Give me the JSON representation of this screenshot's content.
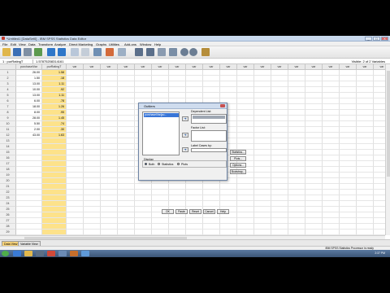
{
  "window": {
    "title": "*Untitled1 [DataSet0] - IBM SPSS Statistics Data Editor",
    "controls": [
      "_",
      "□",
      "X"
    ]
  },
  "menu": [
    "File",
    "Edit",
    "View",
    "Data",
    "Transform",
    "Analyze",
    "Direct Marketing",
    "Graphs",
    "Utilities",
    "Add-ons",
    "Window",
    "Help"
  ],
  "cellbar": {
    "ref": "1 : purRatingT",
    "value": "1.57875208314161",
    "visible": "Visible: 2 of 2 Variables"
  },
  "columns": [
    "purchaseiVar",
    "purRatingT",
    "var",
    "var",
    "var",
    "var",
    "var",
    "var",
    "var",
    "var",
    "var",
    "var",
    "var",
    "var",
    "var",
    "var",
    "var",
    "var",
    "var",
    "var",
    "var"
  ],
  "rows": [
    [
      "26.00",
      "1.58"
    ],
    [
      "1.50",
      ".18"
    ],
    [
      "13.00",
      "1.11"
    ],
    [
      "10.00",
      ".92"
    ],
    [
      "13.00",
      "1.11"
    ],
    [
      "6.00",
      ".78"
    ],
    [
      "18.00",
      "1.26"
    ],
    [
      "8.00",
      ".95"
    ],
    [
      "28.00",
      "1.45"
    ],
    [
      "5.50",
      ".74"
    ],
    [
      "2.00",
      ".30"
    ],
    [
      "43.00",
      "1.63"
    ]
  ],
  "row_count_visible": 31,
  "dialog": {
    "title": "Outliers",
    "variable_list_item": "purchaseiVar[pu...",
    "dependent_label": "Dependent List:",
    "factor_label": "Factor List:",
    "label_label": "Label Cases by:",
    "side_buttons": [
      "Statistics...",
      "Plots...",
      "Options...",
      "Bootstrap..."
    ],
    "display_label": "Display",
    "display_options": [
      "Both",
      "Statistics",
      "Plots"
    ],
    "bottom_buttons": [
      "OK",
      "Paste",
      "Reset",
      "Cancel",
      "Help"
    ]
  },
  "tabs": [
    "Data View",
    "Variable View"
  ],
  "status": "IBM SPSS Statistics Processor is ready",
  "clock": "2:37 PM"
}
